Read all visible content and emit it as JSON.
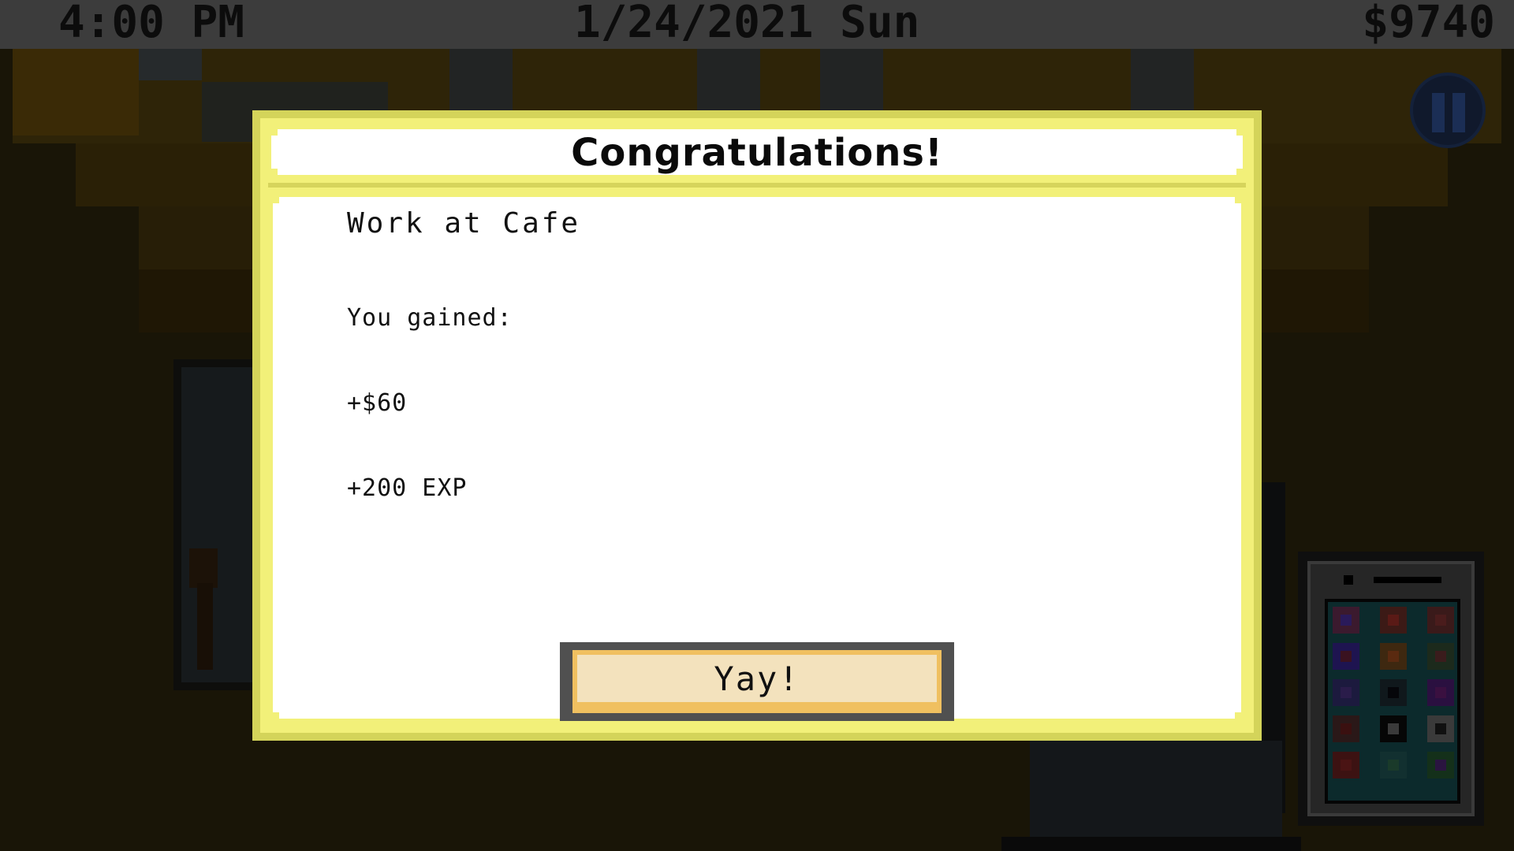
{
  "hud": {
    "time": "4:00 PM",
    "date": "1/24/2021 Sun",
    "money": "$9740"
  },
  "modal": {
    "title": "Congratulations!",
    "activity": "Work at Cafe",
    "gains_header": "You gained:",
    "gains": [
      "+$60",
      "+200 EXP"
    ],
    "button_label": "Yay!"
  },
  "icons": {
    "pause": "pause-icon",
    "phone": "phone-icon"
  },
  "colors": {
    "modal_border": "#f2f079",
    "button_fill": "#f3e2bd",
    "hud_bar": "#3c3c3c"
  }
}
